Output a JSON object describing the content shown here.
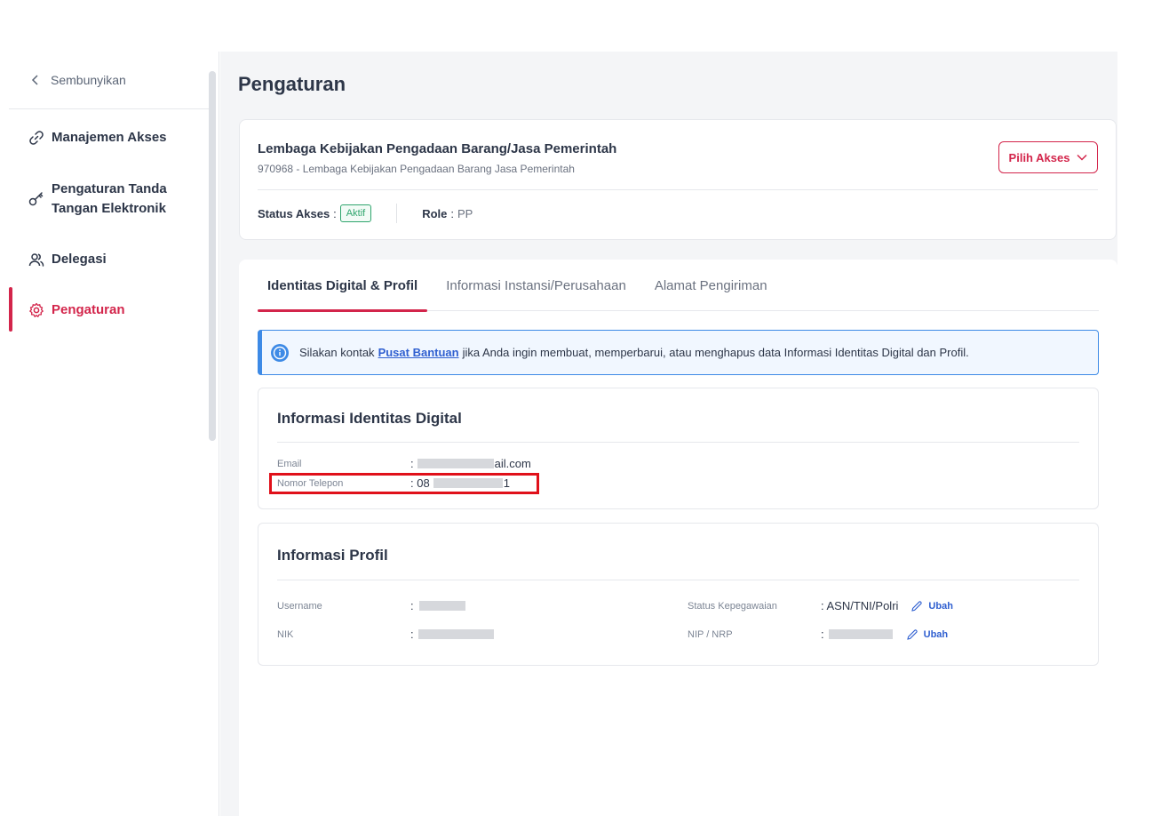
{
  "sidebar": {
    "hide_label": "Sembunyikan",
    "items": [
      {
        "label": "Manajemen Akses",
        "icon": "link-icon"
      },
      {
        "label": "Pengaturan Tanda Tangan Elektronik",
        "icon": "key-icon"
      },
      {
        "label": "Delegasi",
        "icon": "users-icon"
      },
      {
        "label": "Pengaturan",
        "icon": "gear-icon",
        "active": true
      }
    ]
  },
  "page": {
    "title": "Pengaturan"
  },
  "org": {
    "name": "Lembaga Kebijakan Pengadaan Barang/Jasa Pemerintah",
    "sub": "970968 - Lembaga Kebijakan Pengadaan Barang Jasa Pemerintah",
    "pilih_label": "Pilih Akses",
    "status_label": "Status Akses",
    "status_value": "Aktif",
    "role_label": "Role",
    "role_value": "PP"
  },
  "tabs": [
    {
      "label": "Identitas Digital & Profil",
      "active": true
    },
    {
      "label": "Informasi Instansi/Perusahaan"
    },
    {
      "label": "Alamat Pengiriman"
    }
  ],
  "alert": {
    "before": "Silakan kontak",
    "link": "Pusat Bantuan",
    "after": "jika Anda ingin membuat, memperbarui, atau menghapus data Informasi Identitas Digital dan Profil."
  },
  "identity": {
    "title": "Informasi Identitas Digital",
    "email_label": "Email",
    "email_prefix": ":",
    "email_suffix": "ail.com",
    "phone_label": "Nomor Telepon",
    "phone_prefix": ": 08",
    "phone_suffix": "1"
  },
  "profile": {
    "title": "Informasi Profil",
    "username_label": "Username",
    "nik_label": "NIK",
    "colon": ":",
    "status_label": "Status Kepegawaian",
    "status_value": ": ASN/TNI/Polri",
    "nip_label": "NIP / NRP",
    "edit_label": "Ubah"
  },
  "colors": {
    "accent": "#d3254b",
    "link": "#2f5fd0",
    "success": "#2fa56d",
    "info": "#3d8ae6"
  }
}
